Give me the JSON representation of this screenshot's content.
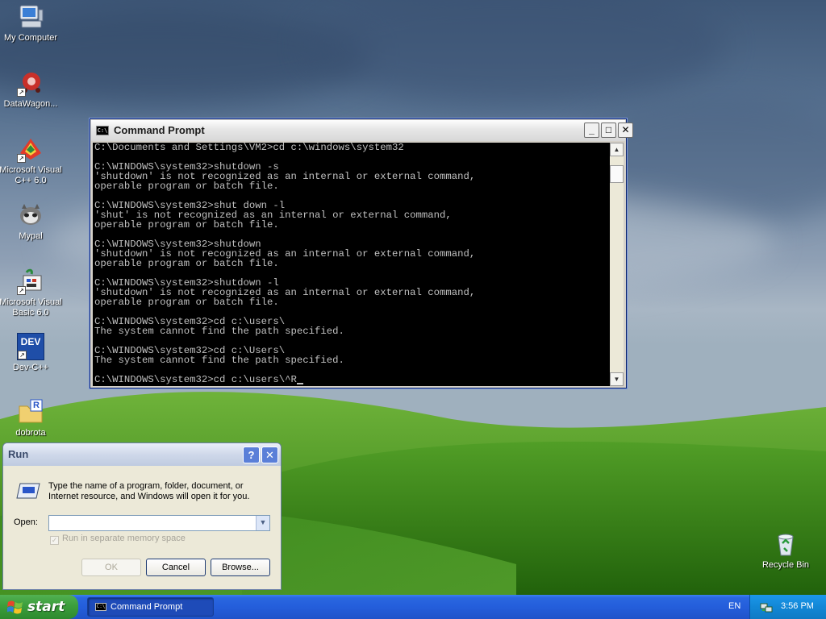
{
  "desktop": {
    "icons": [
      {
        "label": "My Computer",
        "icon": "my-computer-icon"
      },
      {
        "label": "DataWagon...",
        "icon": "datawagon-icon"
      },
      {
        "label": "Microsoft Visual C++ 6.0",
        "icon": "visual-cpp-icon"
      },
      {
        "label": "Mypal",
        "icon": "mypal-icon"
      },
      {
        "label": "Microsoft Visual Basic 6.0",
        "icon": "visual-basic-icon"
      },
      {
        "label": "Dev-C++",
        "icon": "dev-cpp-icon"
      },
      {
        "label": "dobrota",
        "icon": "dobrota-file-icon"
      },
      {
        "label": "Recycle Bin",
        "icon": "recycle-bin-icon"
      }
    ],
    "dev_icon_text": "DEV",
    "dobrota_badge": "R"
  },
  "cmd": {
    "title": "Command Prompt",
    "icon_text": "C:\\",
    "lines": [
      "C:\\Documents and Settings\\VM2>cd c:\\windows\\system32",
      "",
      "C:\\WINDOWS\\system32>shutdown -s",
      "'shutdown' is not recognized as an internal or external command,",
      "operable program or batch file.",
      "",
      "C:\\WINDOWS\\system32>shut down -l",
      "'shut' is not recognized as an internal or external command,",
      "operable program or batch file.",
      "",
      "C:\\WINDOWS\\system32>shutdown",
      "'shutdown' is not recognized as an internal or external command,",
      "operable program or batch file.",
      "",
      "C:\\WINDOWS\\system32>shutdown -l",
      "'shutdown' is not recognized as an internal or external command,",
      "operable program or batch file.",
      "",
      "C:\\WINDOWS\\system32>cd c:\\users\\",
      "The system cannot find the path specified.",
      "",
      "C:\\WINDOWS\\system32>cd c:\\Users\\",
      "The system cannot find the path specified.",
      ""
    ],
    "current_input": "C:\\WINDOWS\\system32>cd c:\\users\\^R",
    "buttons": {
      "minimize": "_",
      "maximize": "□",
      "close": "✕"
    }
  },
  "run": {
    "title": "Run",
    "prompt": "Type the name of a program, folder, document, or Internet resource, and Windows will open it for you.",
    "open_label": "Open:",
    "open_value": "",
    "checkbox_label": "Run in separate memory space",
    "checkbox_checked": true,
    "ok": "OK",
    "cancel": "Cancel",
    "browse": "Browse...",
    "help_btn": "?",
    "close_btn": "✕"
  },
  "taskbar": {
    "start_label": "start",
    "task_label": "Command Prompt",
    "language": "EN",
    "clock": "3:56 PM"
  },
  "colors": {
    "taskbar_blue": "#245edb",
    "start_green": "#3c9e3c",
    "console_bg": "#000000",
    "console_fg": "#c0c0c0"
  }
}
